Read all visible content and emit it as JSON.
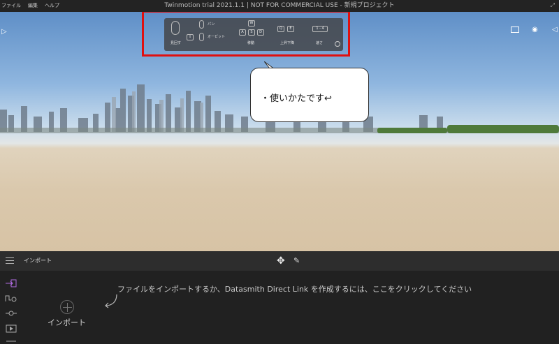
{
  "menu": {
    "items": [
      "ファイル",
      "編集",
      "ヘルプ"
    ]
  },
  "window": {
    "title": "Twinmotion trial 2021.1.1 | NOT FOR COMMERCIAL USE - 新規プロジェクト"
  },
  "hint_panel": {
    "look_label": "見回す",
    "pan_label": "パン",
    "orbit_label": "オービット",
    "move_label": "移動",
    "updown_label": "上昇下降",
    "speed_label": "速さ",
    "speed_keys": "1 - 4",
    "keys_w": "W",
    "keys_a": "A",
    "keys_s": "S",
    "keys_d": "D",
    "keys_q": "Q",
    "keys_e": "E"
  },
  "annotation": {
    "text": "・使いかたです↩",
    "highlight_color": "#e01010"
  },
  "toolbar": {
    "title": "インポート"
  },
  "panel": {
    "instruction": "ファイルをインポートするか、Datasmith Direct Link を作成するには、ここをクリックしてください",
    "import_label": "インポート"
  },
  "icons": [
    "menu-icon",
    "move-gizmo-icon",
    "pen-icon",
    "import-icon",
    "path-icon",
    "connect-icon",
    "media-icon",
    "play-icon",
    "layout-icon",
    "eye-icon",
    "chevron-left-icon",
    "settings-icon"
  ]
}
